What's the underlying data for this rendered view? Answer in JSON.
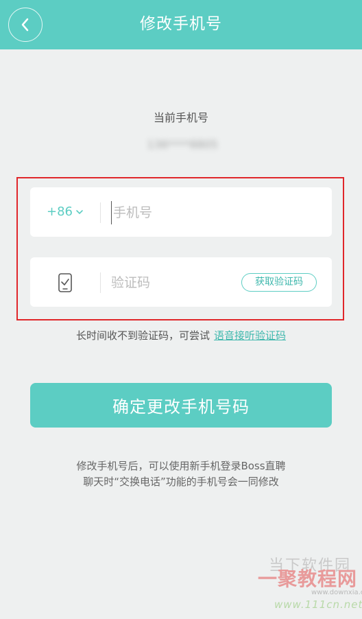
{
  "header": {
    "title": "修改手机号"
  },
  "current_phone": {
    "label": "当前手机号",
    "number_masked": "136****8805"
  },
  "phone_field": {
    "country_code": "+86",
    "placeholder": "手机号",
    "value": ""
  },
  "code_field": {
    "placeholder": "验证码",
    "value": "",
    "get_code_label": "获取验证码"
  },
  "hint": {
    "text": "长时间收不到验证码，可尝试",
    "link": "语音接听验证码"
  },
  "confirm_button": "确定更改手机号码",
  "note": {
    "line1": "修改手机号后，可以使用新手机登录Boss直聘",
    "line2": "聊天时“交换电话”功能的手机号会一同修改"
  },
  "watermark": {
    "top": "当下软件园",
    "mid": "一聚教程网",
    "url1": "www.downxia.com",
    "url2": "www.111cn.net"
  },
  "colors": {
    "accent": "#5ccdc3",
    "highlight_frame": "#e0262a",
    "background": "#eef0f0"
  }
}
